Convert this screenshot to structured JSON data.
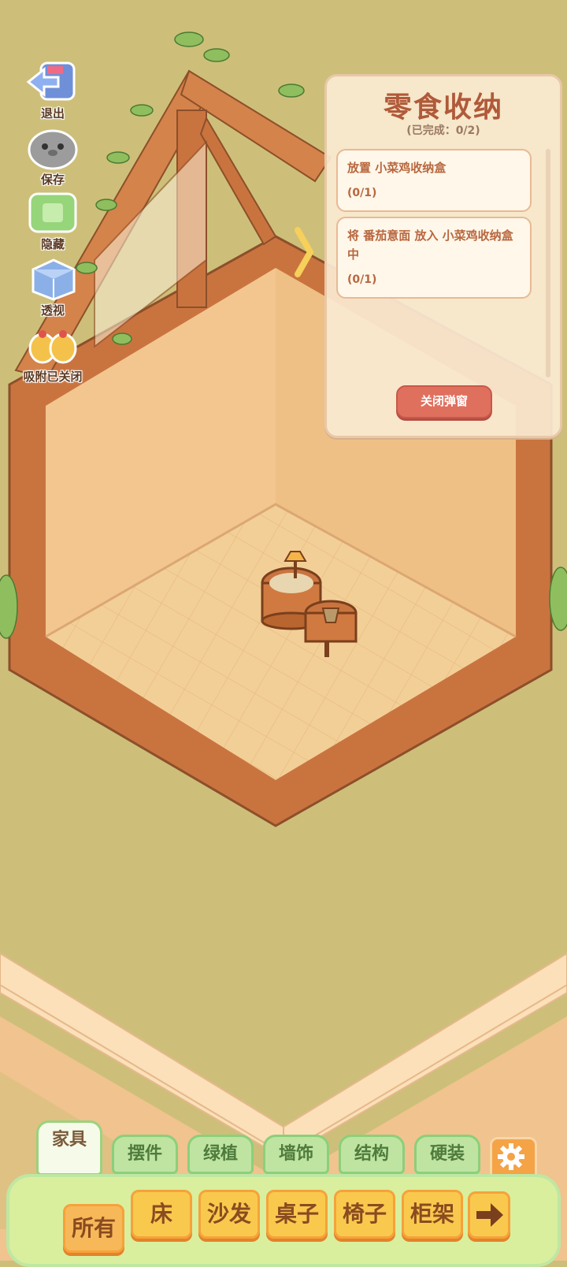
{
  "tools": [
    {
      "id": "exit",
      "label": "退出",
      "icon": "exit-arrow-icon"
    },
    {
      "id": "save",
      "label": "保存",
      "icon": "save-hamster-icon"
    },
    {
      "id": "hide",
      "label": "隐藏",
      "icon": "hide-frame-icon"
    },
    {
      "id": "perspective",
      "label": "透视",
      "icon": "perspective-cube-icon"
    },
    {
      "id": "snap",
      "label": "吸附已关闭",
      "icon": "chick-snap-icon"
    }
  ],
  "quest": {
    "title": "零食收纳",
    "progress": "(已完成：0/2)",
    "tasks": [
      {
        "text": "放置 小菜鸡收纳盒",
        "count": "(0/1)"
      },
      {
        "text": "将 番茄意面 放入 小菜鸡收纳盒中",
        "count": "(0/1)"
      }
    ],
    "close_label": "关闭弹窗"
  },
  "categories": [
    "家具",
    "摆件",
    "绿植",
    "墙饰",
    "结构",
    "硬装"
  ],
  "active_category": "家具",
  "subcategories": [
    "所有",
    "床",
    "沙发",
    "桌子",
    "椅子",
    "柜架"
  ],
  "active_subcategory": "所有",
  "colors": {
    "floor": "#f1c98f",
    "wall": "#f3c690",
    "wood": "#c9743f",
    "grass": "#cbbf7a",
    "accent": "#e0705e"
  }
}
